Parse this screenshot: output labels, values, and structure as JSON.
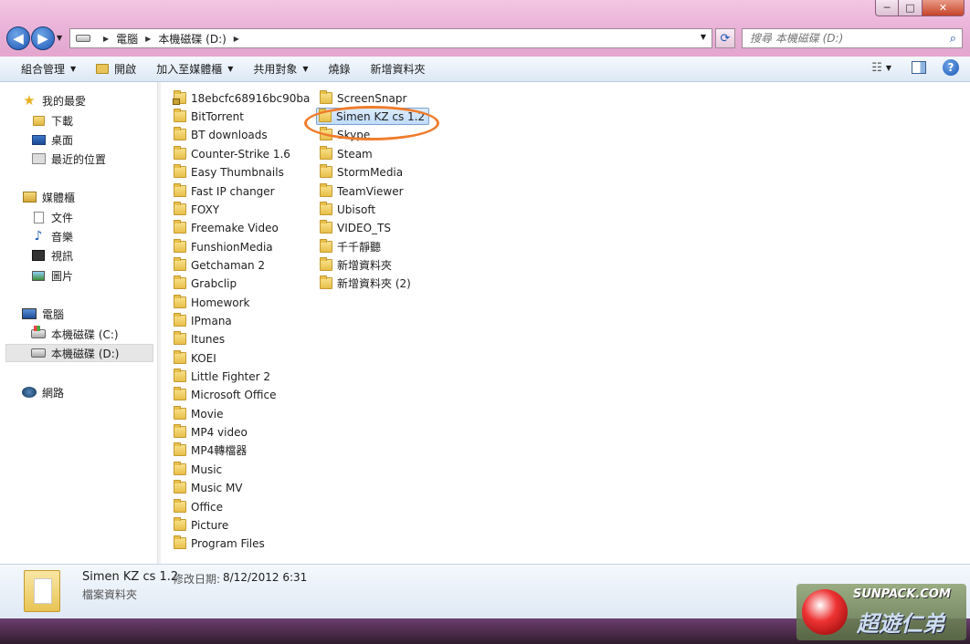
{
  "window": {
    "min": "─",
    "max": "□",
    "close": "✕"
  },
  "nav": {
    "back": "◀",
    "forward": "▶"
  },
  "breadcrumb": [
    "電腦",
    "本機磁碟 (D:)"
  ],
  "search": {
    "placeholder": "搜尋 本機磁碟 (D:)"
  },
  "toolbar": {
    "organize": "組合管理",
    "open": "開啟",
    "include_library": "加入至媒體櫃",
    "share": "共用對象",
    "burn": "燒錄",
    "new_folder": "新增資料夾"
  },
  "sidebar": {
    "favorites": {
      "label": "我的最愛",
      "items": [
        "下載",
        "桌面",
        "最近的位置"
      ]
    },
    "libraries": {
      "label": "媒體櫃",
      "items": [
        "文件",
        "音樂",
        "視訊",
        "圖片"
      ]
    },
    "computer": {
      "label": "電腦",
      "items": [
        "本機磁碟 (C:)",
        "本機磁碟 (D:)"
      ]
    },
    "network": {
      "label": "網路"
    }
  },
  "files": {
    "col1": [
      "18ebcfc68916bc90ba",
      "BitTorrent",
      "BT downloads",
      "Counter-Strike 1.6",
      "Easy Thumbnails",
      "Fast IP changer",
      "FOXY",
      "Freemake Video",
      "FunshionMedia",
      "Getchaman 2",
      "Grabclip",
      "Homework",
      "IPmana",
      "Itunes",
      "KOEI",
      "Little Fighter 2",
      "Microsoft Office",
      "Movie",
      "MP4 video",
      "MP4轉檔器",
      "Music",
      "Music MV",
      "Office",
      "Picture",
      "Program Files"
    ],
    "col2": [
      "ScreenSnapr",
      "Simen KZ cs 1.2",
      "Skype",
      "Steam",
      "StormMedia",
      "TeamViewer",
      "Ubisoft",
      "VIDEO_TS",
      "千千靜聽",
      "新增資料夾",
      "新增資料夾 (2)"
    ],
    "selected": "Simen KZ cs 1.2"
  },
  "details": {
    "name": "Simen KZ cs 1.2",
    "modified_label": "修改日期:",
    "modified_value": "8/12/2012 6:31",
    "type": "檔案資料夾"
  },
  "watermark": {
    "line1": "SUNPACK.COM",
    "line2": "超遊仁弟"
  }
}
